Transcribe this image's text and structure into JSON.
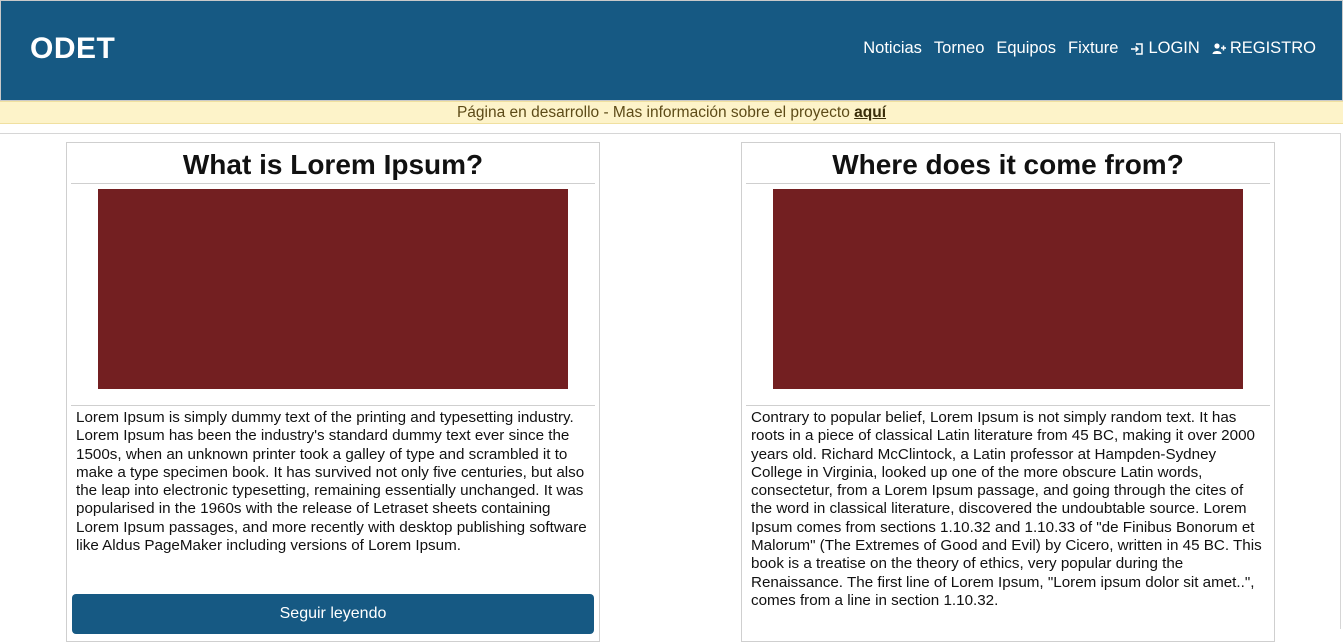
{
  "brand": "ODET",
  "nav": {
    "items": [
      "Noticias",
      "Torneo",
      "Equipos",
      "Fixture"
    ],
    "login": "LOGIN",
    "register": "REGISTRO",
    "login_icon": "sign-in-icon",
    "register_icon": "user-plus-icon"
  },
  "banner": {
    "text": "Página en desarrollo - Mas información sobre el proyecto ",
    "link": "aquí"
  },
  "colors": {
    "header": "#165983",
    "banner": "#fdf3c9",
    "image_placeholder": "#731f21"
  },
  "cards": [
    {
      "title": "What is Lorem Ipsum?",
      "text": "Lorem Ipsum is simply dummy text of the printing and typesetting industry. Lorem Ipsum has been the industry's standard dummy text ever since the 1500s, when an unknown printer took a galley of type and scrambled it to make a type specimen book. It has survived not only five centuries, but also the leap into electronic typesetting, remaining essentially unchanged. It was popularised in the 1960s with the release of Letraset sheets containing Lorem Ipsum passages, and more recently with desktop publishing software like Aldus PageMaker including versions of Lorem Ipsum.",
      "button": "Seguir leyendo"
    },
    {
      "title": "Where does it come from?",
      "text": "Contrary to popular belief, Lorem Ipsum is not simply random text. It has roots in a piece of classical Latin literature from 45 BC, making it over 2000 years old. Richard McClintock, a Latin professor at Hampden-Sydney College in Virginia, looked up one of the more obscure Latin words, consectetur, from a Lorem Ipsum passage, and going through the cites of the word in classical literature, discovered the undoubtable source. Lorem Ipsum comes from sections 1.10.32 and 1.10.33 of \"de Finibus Bonorum et Malorum\" (The Extremes of Good and Evil) by Cicero, written in 45 BC. This book is a treatise on the theory of ethics, very popular during the Renaissance. The first line of Lorem Ipsum, \"Lorem ipsum dolor sit amet..\", comes from a line in section 1.10.32."
    }
  ]
}
